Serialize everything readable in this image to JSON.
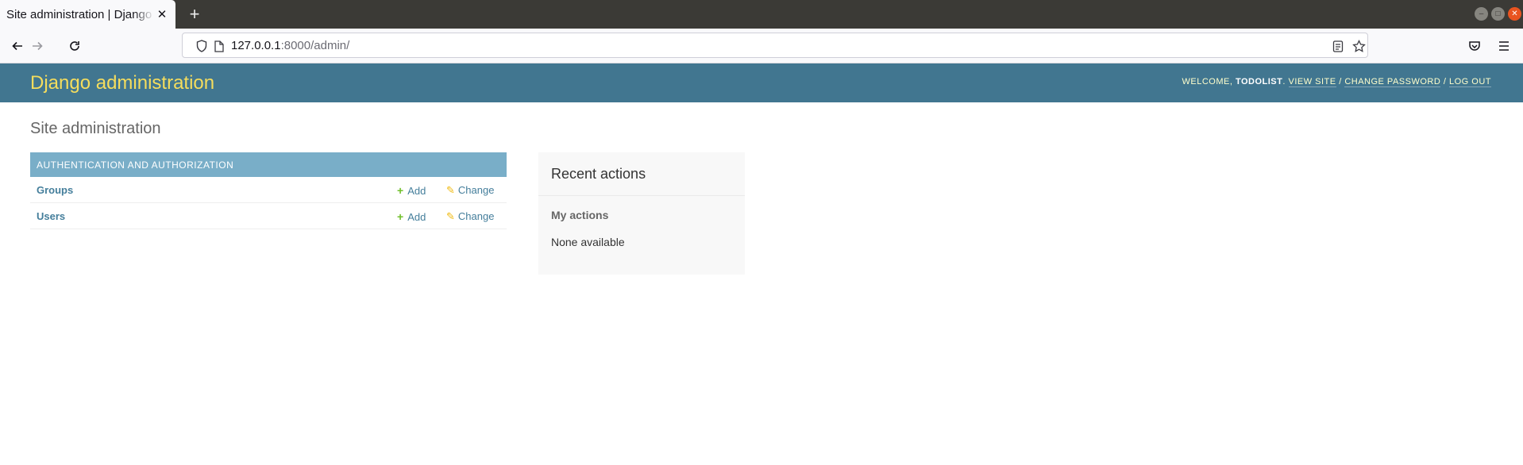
{
  "browser": {
    "tab_title": "Site administration | Django site admin",
    "url_host": "127.0.0.1",
    "url_rest": ":8000/admin/"
  },
  "header": {
    "branding": "Django administration",
    "welcome": "Welcome,",
    "username": "todolist",
    "view_site": "View site",
    "change_password": "Change password",
    "log_out": "Log out",
    "sep": "/"
  },
  "page": {
    "title": "Site administration"
  },
  "apps": [
    {
      "caption": "Authentication and Authorization",
      "models": [
        {
          "name": "Groups",
          "add_label": "Add",
          "change_label": "Change"
        },
        {
          "name": "Users",
          "add_label": "Add",
          "change_label": "Change"
        }
      ]
    }
  ],
  "recent_actions": {
    "title": "Recent actions",
    "subtitle": "My actions",
    "empty": "None available"
  },
  "colors": {
    "header_bg": "#417690",
    "branding": "#f5dd5d",
    "caption_bg": "#79aec8",
    "link": "#447e9b",
    "add_icon": "#70bf2b",
    "change_icon": "#efb80b"
  }
}
